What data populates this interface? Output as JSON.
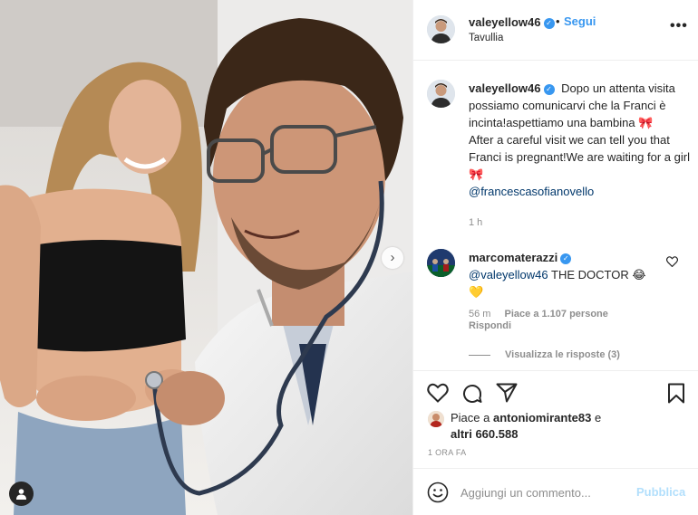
{
  "post": {
    "author": "valeyellow46",
    "follow_label": "Segui",
    "dot": "•",
    "location": "Tavullia",
    "more": "•••",
    "verified_mark": "✓"
  },
  "caption": {
    "author": "valeyellow46",
    "text_it": "Dopo un attenta visita possiamo comunicarvi che la Franci è incinta!aspettiamo una bambina",
    "text_en": "After a careful visit we can tell you that Franci is pregnant!We are waiting for a girl",
    "emoji": "🎀",
    "mention": "@francescasofianovello",
    "time": "1 h"
  },
  "comment": {
    "author": "marcomaterazzi",
    "mention": "@valeyellow46",
    "text": "THE DOCTOR",
    "emoji_laugh": "😂",
    "emoji_heart": "💛",
    "time": "56 m",
    "likes": "Piace a 1.107 persone",
    "reply_label": "Rispondi",
    "view_replies": "Visualizza le risposte (3)"
  },
  "likes": {
    "prefix": "Piace a",
    "user": "antoniomirante83",
    "joiner": "e",
    "others": "altri 660.588"
  },
  "date": "1 ORA FA",
  "add_comment": {
    "placeholder": "Aggiungi un commento...",
    "publish_label": "Pubblica"
  },
  "photo": {
    "next_icon": "›"
  },
  "icons": [
    "heart-icon",
    "comment-icon",
    "share-icon",
    "bookmark-icon",
    "smile-icon",
    "user-tag-icon",
    "more-icon",
    "chevron-right-icon"
  ],
  "colors": {
    "accent": "#3897f0",
    "muted": "#8e8e8e",
    "text": "#262626",
    "publish_disabled": "#b2dffc"
  }
}
